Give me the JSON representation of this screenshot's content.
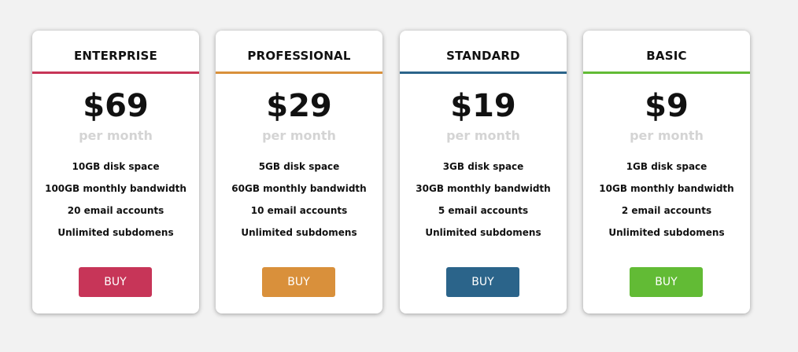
{
  "plans": [
    {
      "name": "ENTERPRISE",
      "price": "$69",
      "period": "per month",
      "features": [
        "10GB disk space",
        "100GB monthly bandwidth",
        "20 email accounts",
        "Unlimited subdomens"
      ],
      "button_label": "BUY",
      "accent": "#c73558"
    },
    {
      "name": "PROFESSIONAL",
      "price": "$29",
      "period": "per month",
      "features": [
        "5GB disk space",
        "60GB monthly bandwidth",
        "10 email accounts",
        "Unlimited subdomens"
      ],
      "button_label": "BUY",
      "accent": "#d9903b"
    },
    {
      "name": "STANDARD",
      "price": "$19",
      "period": "per month",
      "features": [
        "3GB disk space",
        "30GB monthly bandwidth",
        "5 email accounts",
        "Unlimited subdomens"
      ],
      "button_label": "BUY",
      "accent": "#2b648a"
    },
    {
      "name": "BASIC",
      "price": "$9",
      "period": "per month",
      "features": [
        "1GB disk space",
        "10GB monthly bandwidth",
        "2 email accounts",
        "Unlimited subdomens"
      ],
      "button_label": "BUY",
      "accent": "#62bb35"
    }
  ]
}
